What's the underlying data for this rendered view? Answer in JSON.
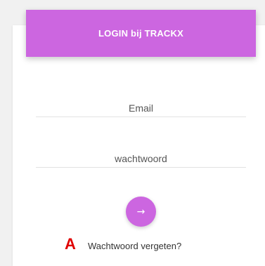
{
  "header": {
    "title": "LOGIN bij TRACKX"
  },
  "form": {
    "email_placeholder": "Email",
    "password_placeholder": "wachtwoord",
    "submit_icon": "arrow-right-icon",
    "submit_glyph": "→"
  },
  "links": {
    "forgot_password": "Wachtwoord vergeten?"
  },
  "annotation": {
    "marker": "A"
  },
  "colors": {
    "accent": "#cc66e0",
    "annotation": "#e00000"
  }
}
